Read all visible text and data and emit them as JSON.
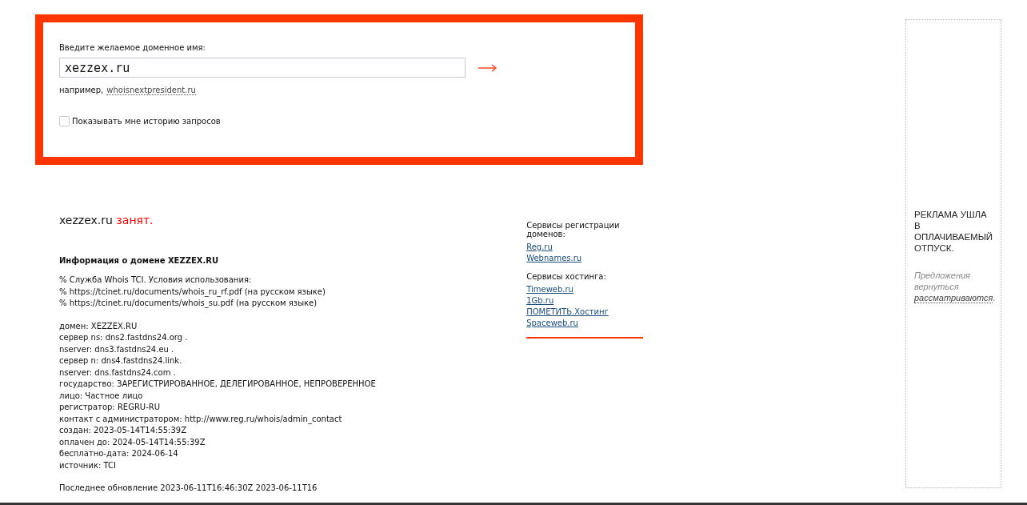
{
  "search": {
    "label": "Введите желаемое доменное имя:",
    "value": "xezzex.ru",
    "example_prefix": "например,",
    "example_link": "whoisnextpresident.ru",
    "history_checkbox": {
      "label": "Показывать мне историю запросов",
      "checked": false
    }
  },
  "result": {
    "domain": "xezzex.ru",
    "status": "занят.",
    "heading": "Информация о домене XEZZEX.RU",
    "notice": [
      "% Служба Whois TCI. Условия использования:",
      "% https://tcinet.ru/documents/whois_ru_rf.pdf (на русском языке)",
      "% https://tcinet.ru/documents/whois_su.pdf (на русском языке)"
    ],
    "records": [
      "домен: XEZZEX.RU",
      "сервер ns: dns2.fastdns24.org .",
      "nserver: dns3.fastdns24.eu .",
      "сервер n: dns4.fastdns24.link.",
      "nserver: dns.fastdns24.com .",
      "государство: ЗАРЕГИСТРИРОВАННОЕ, ДЕЛЕГИРОВАННОЕ, НЕПРОВЕРЕННОЕ",
      "лицо: Частное лицо",
      "регистратор: REGRU-RU",
      "контакт с администратором: http://www.reg.ru/whois/admin_contact",
      "создан: 2023-05-14T14:55:39Z",
      "оплачен до: 2024-05-14T14:55:39Z",
      "бесплатно-дата: 2024-06-14",
      "источник: TCI"
    ],
    "last_update": "Последнее обновление 2023-06-11T16:46:30Z 2023-06-11T16"
  },
  "services": [
    {
      "title": "Сервисы регистрации доменов:",
      "links": [
        "Reg.ru",
        "Webnames.ru"
      ]
    },
    {
      "title": "Сервисы хостинга:",
      "links": [
        "Timeweb.ru",
        "1Gb.ru",
        "ПОМЕТИТЬ.Хостинг",
        "Spaceweb.ru"
      ]
    }
  ],
  "ad": {
    "headline": "РЕКЛАМА УШЛА В ОПЛАЧИВАЕМЫЙ ОТПУСК.",
    "note_before": "Предложения вернуться",
    "note_link": "рассматриваются",
    "note_after": "."
  }
}
